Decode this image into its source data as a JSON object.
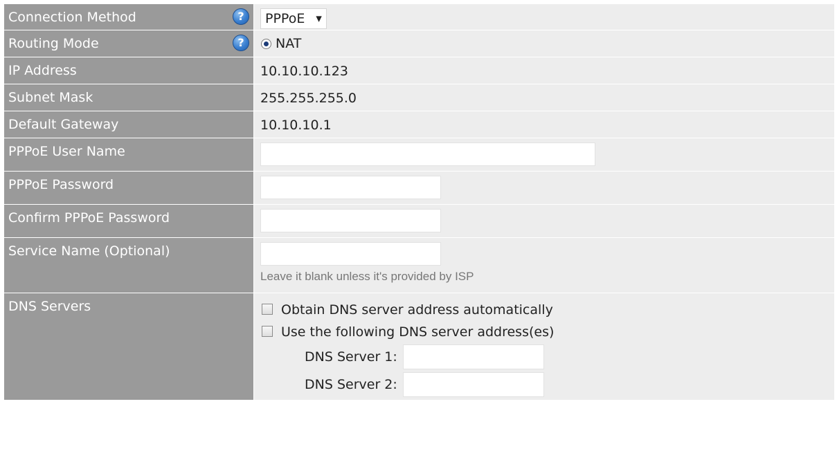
{
  "rows": {
    "connection_method": {
      "label": "Connection Method",
      "value": "PPPoE"
    },
    "routing_mode": {
      "label": "Routing Mode",
      "value": "NAT"
    },
    "ip_address": {
      "label": "IP Address",
      "value": "10.10.10.123"
    },
    "subnet_mask": {
      "label": "Subnet Mask",
      "value": "255.255.255.0"
    },
    "default_gateway": {
      "label": "Default Gateway",
      "value": "10.10.10.1"
    },
    "pppoe_user_name": {
      "label": "PPPoE User Name",
      "value": ""
    },
    "pppoe_password": {
      "label": "PPPoE Password",
      "value": ""
    },
    "confirm_pppoe_password": {
      "label": "Confirm PPPoE Password",
      "value": ""
    },
    "service_name": {
      "label": "Service Name (Optional)",
      "value": "",
      "hint": "Leave it blank unless it's provided by ISP"
    },
    "dns_servers": {
      "label": "DNS Servers",
      "obtain_auto": {
        "label": "Obtain DNS server address automatically",
        "checked": false
      },
      "use_following": {
        "label": "Use the following DNS server address(es)",
        "checked": false
      },
      "dns1": {
        "label": "DNS Server 1:",
        "value": ""
      },
      "dns2": {
        "label": "DNS Server 2:",
        "value": ""
      }
    }
  },
  "icons": {
    "help": "help-icon",
    "help_glyph": "?",
    "dropdown": "chevron-down-icon",
    "dropdown_glyph": "▼"
  },
  "colors": {
    "label_bg": "#9a9a9a",
    "value_bg": "#ededed",
    "help_icon": "#3a7fd0"
  }
}
